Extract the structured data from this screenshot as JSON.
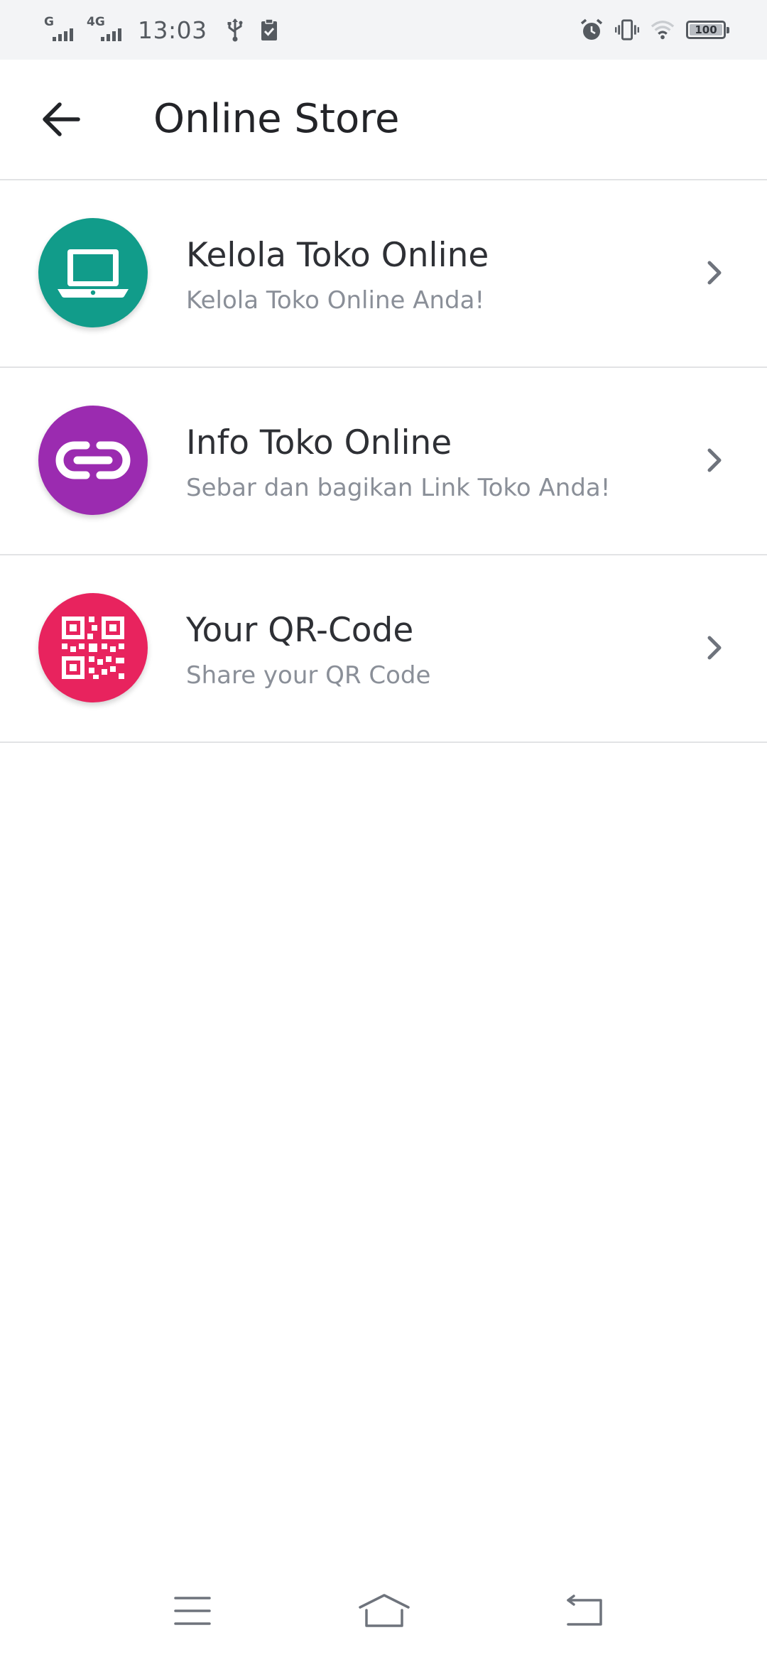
{
  "status_bar": {
    "network_1": "G",
    "network_2": "4G",
    "time": "13:03",
    "battery_level": 100,
    "battery_text": "100",
    "left_icons": [
      "usb-icon",
      "clipboard-check-icon"
    ],
    "right_icons": [
      "alarm-icon",
      "vibrate-icon",
      "wifi-icon",
      "battery-icon"
    ]
  },
  "header": {
    "title": "Online Store",
    "back_icon": "arrow-left-icon"
  },
  "menu": {
    "items": [
      {
        "title": "Kelola Toko Online",
        "subtitle": "Kelola Toko Online Anda!",
        "icon": "laptop-icon",
        "color": "#119c8a"
      },
      {
        "title": "Info Toko Online",
        "subtitle": "Sebar dan bagikan Link Toko Anda!",
        "icon": "link-icon",
        "color": "#9b2bb0"
      },
      {
        "title": "Your QR-Code",
        "subtitle": "Share your QR Code",
        "icon": "qr-code-icon",
        "color": "#e8235e"
      }
    ]
  },
  "nav_bar": {
    "icons": [
      "menu-icon",
      "home-icon",
      "back-icon"
    ]
  },
  "colors": {
    "status_bar_bg": "#f3f4f6",
    "divider": "#e2e3e5",
    "title_text": "#232428",
    "subtitle_text": "#8a8f98",
    "chevron": "#6e737c"
  }
}
